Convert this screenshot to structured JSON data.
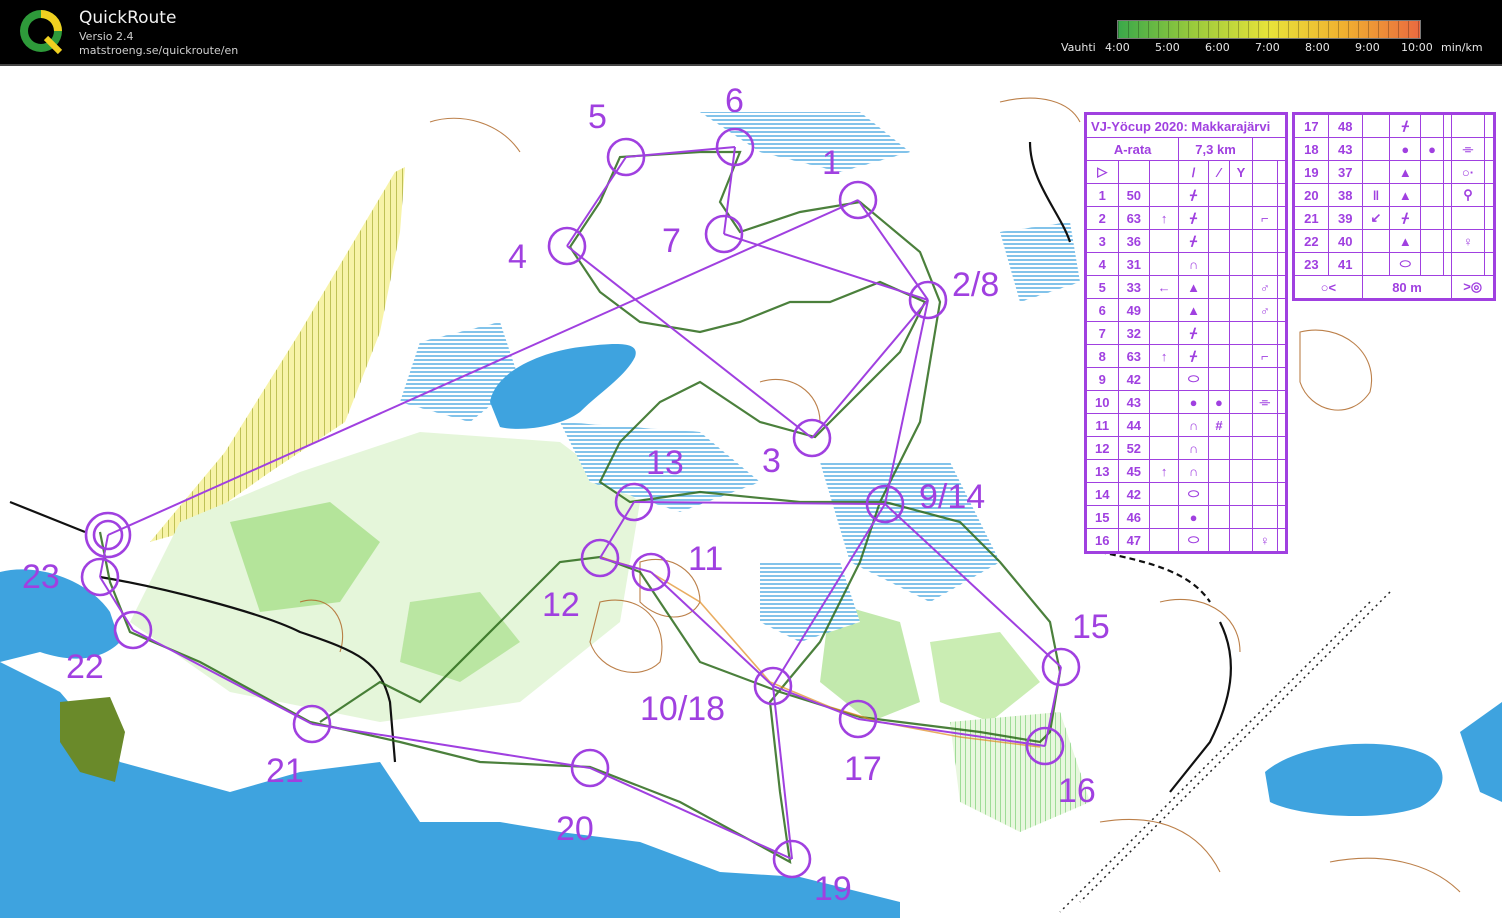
{
  "app": {
    "title": "QuickRoute",
    "version": "Versio 2.4",
    "url": "matstroeng.se/quickroute/en",
    "logo_letter": "Q"
  },
  "pace_scale": {
    "label": "Vauhti",
    "ticks": [
      "4:00",
      "5:00",
      "6:00",
      "7:00",
      "8:00",
      "9:00",
      "10:00"
    ],
    "unit": "min/km",
    "colors": [
      "#3aa84a",
      "#9acb3c",
      "#e8e33a",
      "#f0b030",
      "#ea6a40"
    ]
  },
  "map_colors": {
    "water": "#3ea3df",
    "marsh": "#9dd3ee",
    "vegetation": "#7ed26a",
    "light_green": "#d4f0c2",
    "course": "#a040e0",
    "contour": "#b06a2a",
    "route": "#1a6a2a",
    "yellow_hatch": "#f0ea60"
  },
  "controls": {
    "labels": [
      "1",
      "2/8",
      "3",
      "4",
      "5",
      "6",
      "7",
      "9/14",
      "10/18",
      "11",
      "12",
      "13",
      "15",
      "16",
      "17",
      "19",
      "20",
      "21",
      "22",
      "23"
    ]
  },
  "course_info": {
    "event": "VJ-Yöcup 2020: Makkarajärvi",
    "course": "A-rata",
    "length": "7,3 km",
    "finish_distance": "80 m",
    "rows_left": [
      {
        "n": "1",
        "code": "50",
        "d": "",
        "f": "ᚋ",
        "g": "",
        "h": ""
      },
      {
        "n": "2",
        "code": "63",
        "d": "↑",
        "f": "ᚋ",
        "g": "",
        "h": "⌐"
      },
      {
        "n": "3",
        "code": "36",
        "d": "",
        "f": "ᚋ",
        "g": "",
        "h": ""
      },
      {
        "n": "4",
        "code": "31",
        "d": "",
        "f": "∩",
        "g": "",
        "h": ""
      },
      {
        "n": "5",
        "code": "33",
        "d": "←",
        "f": "▲",
        "g": "",
        "h": "♂"
      },
      {
        "n": "6",
        "code": "49",
        "d": "",
        "f": "▲",
        "g": "",
        "h": "♂"
      },
      {
        "n": "7",
        "code": "32",
        "d": "",
        "f": "ᚋ",
        "g": "",
        "h": ""
      },
      {
        "n": "8",
        "code": "63",
        "d": "↑",
        "f": "ᚋ",
        "g": "",
        "h": "⌐"
      },
      {
        "n": "9",
        "code": "42",
        "d": "",
        "f": "⬭",
        "g": "",
        "h": ""
      },
      {
        "n": "10",
        "code": "43",
        "d": "",
        "f": "●",
        "g": "●",
        "h": "⌯"
      },
      {
        "n": "11",
        "code": "44",
        "d": "",
        "f": "∩",
        "g": "#",
        "h": ""
      },
      {
        "n": "12",
        "code": "52",
        "d": "",
        "f": "∩",
        "g": "",
        "h": ""
      },
      {
        "n": "13",
        "code": "45",
        "d": "↑",
        "f": "∩",
        "g": "",
        "h": ""
      },
      {
        "n": "14",
        "code": "42",
        "d": "",
        "f": "⬭",
        "g": "",
        "h": ""
      },
      {
        "n": "15",
        "code": "46",
        "d": "",
        "f": "●",
        "g": "",
        "h": ""
      },
      {
        "n": "16",
        "code": "47",
        "d": "",
        "f": "⬭",
        "g": "",
        "h": "♀"
      }
    ],
    "rows_right": [
      {
        "n": "17",
        "code": "48",
        "d": "",
        "f": "ᚋ",
        "g": "",
        "h": ""
      },
      {
        "n": "18",
        "code": "43",
        "d": "",
        "f": "●",
        "g": "●",
        "h": "⌯"
      },
      {
        "n": "19",
        "code": "37",
        "d": "",
        "f": "▲",
        "g": "",
        "h": "○·"
      },
      {
        "n": "20",
        "code": "38",
        "d": "ǁ",
        "f": "▲",
        "g": "",
        "h": "⚲"
      },
      {
        "n": "21",
        "code": "39",
        "d": "↙",
        "f": "ᚋ",
        "g": "",
        "h": ""
      },
      {
        "n": "22",
        "code": "40",
        "d": "",
        "f": "▲",
        "g": "",
        "h": "♀"
      },
      {
        "n": "23",
        "code": "41",
        "d": "",
        "f": "⬭",
        "g": "",
        "h": ""
      }
    ]
  }
}
